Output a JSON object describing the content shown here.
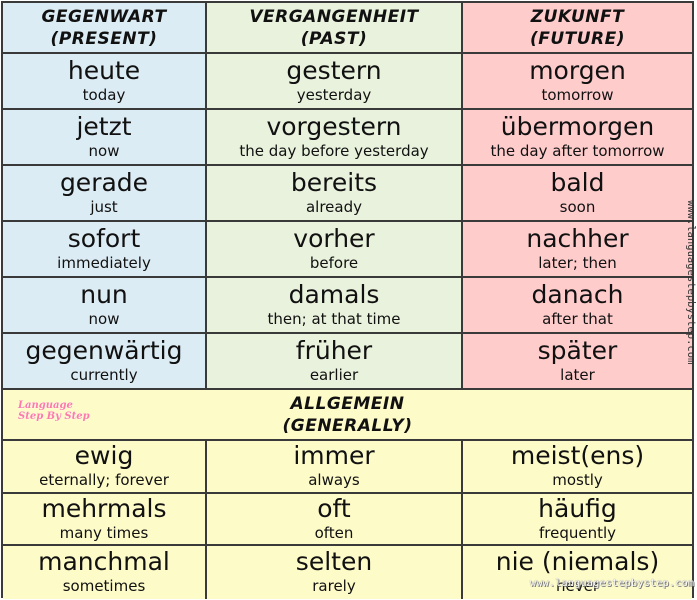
{
  "headers": [
    {
      "title": "GEGENWART",
      "subtitle": "(PRESENT)"
    },
    {
      "title": "VERGANGENHEIT",
      "subtitle": "(PAST)"
    },
    {
      "title": "ZUKUNFT",
      "subtitle": "(FUTURE)"
    }
  ],
  "time_rows": [
    [
      {
        "de": "heute",
        "en": "today"
      },
      {
        "de": "gestern",
        "en": "yesterday"
      },
      {
        "de": "morgen",
        "en": "tomorrow"
      }
    ],
    [
      {
        "de": "jetzt",
        "en": "now"
      },
      {
        "de": "vorgestern",
        "en": "the day before yesterday"
      },
      {
        "de": "übermorgen",
        "en": "the day after tomorrow"
      }
    ],
    [
      {
        "de": "gerade",
        "en": "just"
      },
      {
        "de": "bereits",
        "en": "already"
      },
      {
        "de": "bald",
        "en": "soon"
      }
    ],
    [
      {
        "de": "sofort",
        "en": "immediately"
      },
      {
        "de": "vorher",
        "en": "before"
      },
      {
        "de": "nachher",
        "en": "later; then"
      }
    ],
    [
      {
        "de": "nun",
        "en": "now"
      },
      {
        "de": "damals",
        "en": "then; at that time"
      },
      {
        "de": "danach",
        "en": "after that"
      }
    ],
    [
      {
        "de": "gegenwärtig",
        "en": "currently"
      },
      {
        "de": "früher",
        "en": "earlier"
      },
      {
        "de": "später",
        "en": "later"
      }
    ]
  ],
  "general_header": {
    "title": "ALLGEMEIN",
    "subtitle": "(GENERALLY)"
  },
  "general_rows": [
    [
      {
        "de": "ewig",
        "en": "eternally; forever"
      },
      {
        "de": "immer",
        "en": "always"
      },
      {
        "de": "meist(ens)",
        "en": "mostly"
      }
    ],
    [
      {
        "de": "mehrmals",
        "en": "many times"
      },
      {
        "de": "oft",
        "en": "often"
      },
      {
        "de": "häufig",
        "en": "frequently"
      }
    ],
    [
      {
        "de": "manchmal",
        "en": "sometimes"
      },
      {
        "de": "selten",
        "en": "rarely"
      },
      {
        "de": "nie (niemals)",
        "en": "never"
      }
    ]
  ],
  "logo": {
    "line1": "Language",
    "line2": "Step By Step"
  },
  "watermark": "www.languagestepbystep.com",
  "colors": {
    "present": "#dcecf4",
    "past": "#e9f2dc",
    "future": "#ffcccc",
    "general": "#fdfbc8",
    "border": "#3a3a3a"
  }
}
